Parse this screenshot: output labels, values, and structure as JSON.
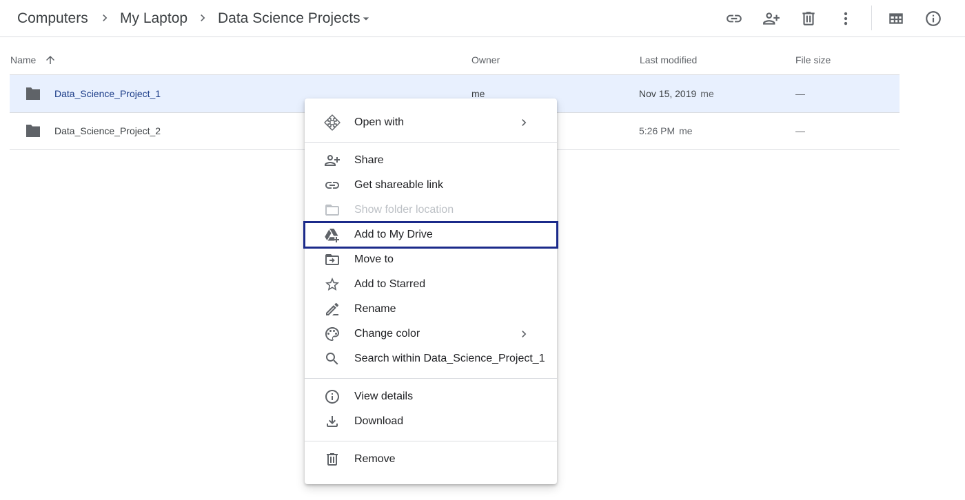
{
  "breadcrumb": {
    "items": [
      "Computers",
      "My Laptop",
      "Data Science Projects"
    ]
  },
  "toolbar": {
    "icons": [
      "link-icon",
      "add-person-icon",
      "trash-icon",
      "more-vert-icon",
      "grid-view-icon",
      "info-icon"
    ]
  },
  "columns": {
    "name": "Name",
    "owner": "Owner",
    "last_modified": "Last modified",
    "file_size": "File size"
  },
  "rows": [
    {
      "name": "Data_Science_Project_1",
      "owner": "me",
      "modified_date": "Nov 15, 2019",
      "modified_by": "me",
      "size": "—",
      "selected": true
    },
    {
      "name": "Data_Science_Project_2",
      "owner": "",
      "modified_date": "5:26 PM",
      "modified_by": "me",
      "size": "—",
      "selected": false
    }
  ],
  "context_menu": {
    "open_with": "Open with",
    "share": "Share",
    "get_link": "Get shareable link",
    "show_location": "Show folder location",
    "add_to_drive": "Add to My Drive",
    "move_to": "Move to",
    "add_starred": "Add to Starred",
    "rename": "Rename",
    "change_color": "Change color",
    "search_within": "Search within Data_Science_Project_1",
    "view_details": "View details",
    "download": "Download",
    "remove": "Remove"
  },
  "colors": {
    "selected_row": "#e8f0fe",
    "highlight_outline": "#1b2a8a",
    "divider": "#dadce0"
  }
}
